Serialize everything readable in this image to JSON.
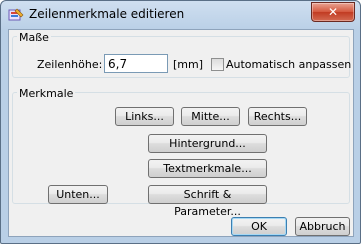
{
  "window": {
    "title": "Zeilenmerkmale editieren",
    "close_symbol": "✕"
  },
  "masse": {
    "group_title": "Maße",
    "line_height_label": "Zeilenhöhe:",
    "line_height_value": "6,7",
    "unit_label": "[mm]",
    "auto_adjust_label": "Automatisch anpassen",
    "auto_adjust_checked": false
  },
  "merkmale": {
    "group_title": "Merkmale",
    "links_label": "Links...",
    "mitte_label": "Mitte...",
    "rechts_label": "Rechts...",
    "hintergrund_label": "Hintergrund...",
    "textmerkmale_label": "Textmerkmale...",
    "unten_label": "Unten...",
    "schrift_label": "Schrift & Parameter..."
  },
  "footer": {
    "ok_label": "OK",
    "cancel_label": "Abbruch"
  }
}
